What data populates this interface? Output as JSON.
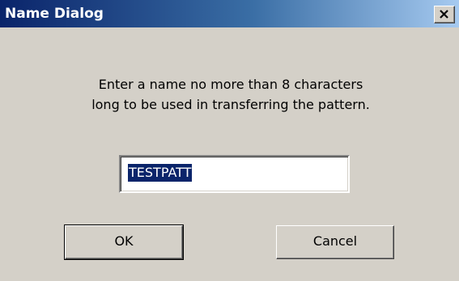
{
  "window": {
    "title": "Name Dialog",
    "close_icon": "close-x-icon"
  },
  "message": {
    "line1": "Enter a name no more than 8 characters",
    "line2": "long to be used in transferring the pattern."
  },
  "name_field": {
    "value": "TESTPATT"
  },
  "buttons": {
    "ok_label": "OK",
    "cancel_label": "Cancel"
  },
  "colors": {
    "titlebar_start": "#0a246a",
    "titlebar_end": "#a6caf0",
    "face": "#d4d0c8",
    "selection": "#0a246a"
  }
}
